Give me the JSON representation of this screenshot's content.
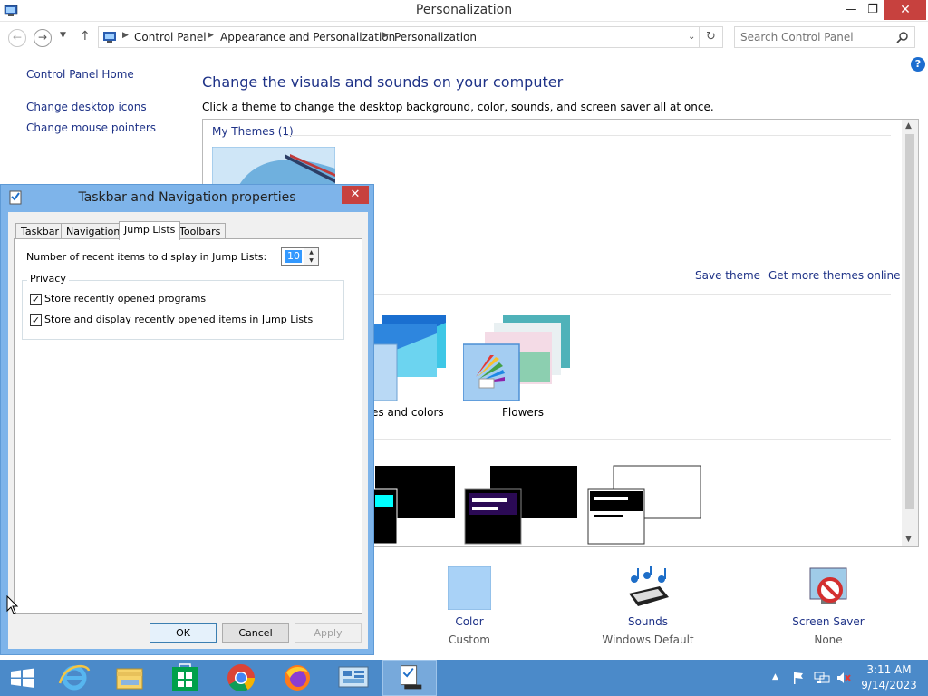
{
  "window": {
    "title": "Personalization",
    "minimize": "—",
    "restore": "❐",
    "close": "✕"
  },
  "address": {
    "crumbs": [
      "Control Panel",
      "Appearance and Personalization",
      "Personalization"
    ],
    "search_placeholder": "Search Control Panel"
  },
  "left_nav": {
    "home": "Control Panel Home",
    "links": [
      "Change desktop icons",
      "Change mouse pointers"
    ]
  },
  "main": {
    "heading": "Change the visuals and sounds on your computer",
    "description": "Click a theme to change the desktop background, color, sounds, and screen saver all at once.",
    "my_themes_label": "My Themes (1)",
    "save_theme": "Save theme",
    "get_more": "Get more themes online",
    "themes": [
      {
        "label": "es and colors"
      },
      {
        "label": "Flowers"
      }
    ]
  },
  "bottom": [
    {
      "label": "Color",
      "sub": "Custom"
    },
    {
      "label": "Sounds",
      "sub": "Windows Default"
    },
    {
      "label": "Screen Saver",
      "sub": "None"
    }
  ],
  "dialog": {
    "title": "Taskbar and Navigation properties",
    "tabs": [
      "Taskbar",
      "Navigation",
      "Jump Lists",
      "Toolbars"
    ],
    "active_tab": "Jump Lists",
    "recent_label": "Number of recent items to display in Jump Lists:",
    "recent_value": "10",
    "privacy_title": "Privacy",
    "checkboxes": [
      {
        "label": "Store recently opened programs",
        "checked": true
      },
      {
        "label": "Store and display recently opened items in Jump Lists",
        "checked": true
      }
    ],
    "buttons": {
      "ok": "OK",
      "cancel": "Cancel",
      "apply": "Apply"
    }
  },
  "taskbar": {
    "time": "3:11 AM",
    "date": "9/14/2023"
  },
  "colors": {
    "link": "#1e3287",
    "taskbar": "#4b8ac9",
    "dialog_frame": "#7eb4ea"
  }
}
